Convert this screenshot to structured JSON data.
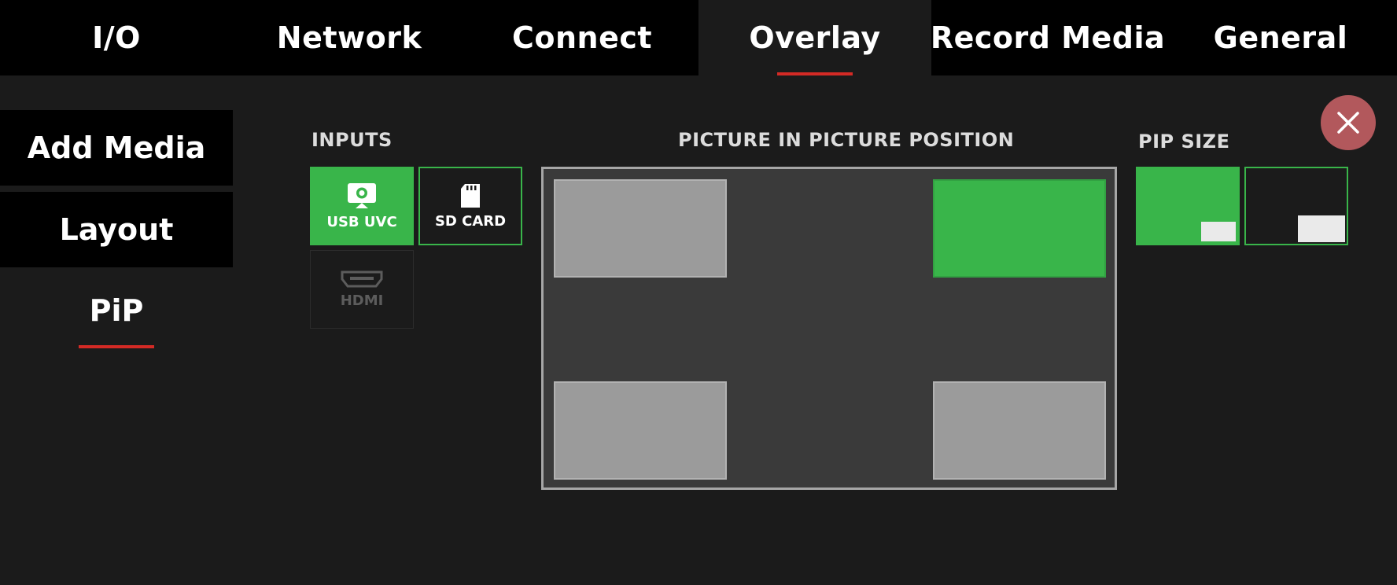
{
  "top_tabs": [
    {
      "label": "I/O"
    },
    {
      "label": "Network"
    },
    {
      "label": "Connect"
    },
    {
      "label": "Overlay",
      "active": true
    },
    {
      "label": "Record Media"
    },
    {
      "label": "General"
    }
  ],
  "side_menu": [
    {
      "label": "Add Media"
    },
    {
      "label": "Layout"
    },
    {
      "label": "PiP",
      "active": true
    }
  ],
  "inputs": {
    "title": "INPUTS",
    "items": [
      {
        "label": "USB UVC",
        "icon": "webcam-icon",
        "state": "selected"
      },
      {
        "label": "SD CARD",
        "icon": "sd-card-icon",
        "state": "available"
      },
      {
        "label": "HDMI",
        "icon": "hdmi-icon",
        "state": "disabled"
      }
    ]
  },
  "pip_position": {
    "title": "PICTURE IN PICTURE POSITION",
    "slots": [
      "top-left",
      "top-right",
      "bottom-left",
      "bottom-right"
    ],
    "selected": "top-right"
  },
  "pip_size": {
    "title": "PIP SIZE",
    "options": [
      "small",
      "large"
    ],
    "selected": "small"
  },
  "close": {
    "icon": "close-icon"
  },
  "colors": {
    "accent_green": "#39b54a",
    "active_underline": "#d42a25",
    "close_button": "#b2585c",
    "background": "#1b1b1b"
  }
}
